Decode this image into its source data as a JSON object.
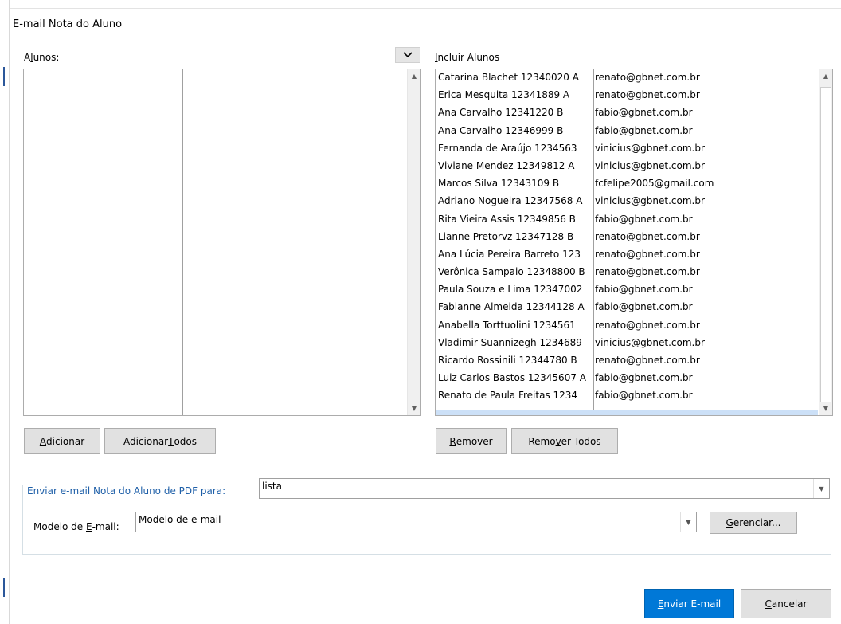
{
  "dialog": {
    "title": "E-mail Nota do Aluno"
  },
  "left": {
    "label_prefix": "A",
    "label_mnemonic": "l",
    "label_suffix": "unos:",
    "add_button": {
      "m": "A",
      "rest": "dicionar"
    },
    "add_all_button": {
      "pre": "Adicionar ",
      "m": "T",
      "rest": "odos"
    }
  },
  "right": {
    "label_mnemonic": "I",
    "label_rest": "ncluir Alunos",
    "rows": [
      {
        "name": "Catarina Blachet 12340020 A",
        "email": "renato@gbnet.com.br"
      },
      {
        "name": "Erica Mesquita 12341889 A",
        "email": "renato@gbnet.com.br"
      },
      {
        "name": "Ana Carvalho 12341220 B",
        "email": "fabio@gbnet.com.br"
      },
      {
        "name": "Ana Carvalho 12346999 B",
        "email": "fabio@gbnet.com.br"
      },
      {
        "name": "Fernanda de Araújo  1234563",
        "email": "vinicius@gbnet.com.br"
      },
      {
        "name": "Viviane Mendez 12349812 A",
        "email": "vinicius@gbnet.com.br"
      },
      {
        "name": "Marcos Silva 12343109 B",
        "email": "fcfelipe2005@gmail.com"
      },
      {
        "name": "Adriano Nogueira 12347568 A",
        "email": "vinicius@gbnet.com.br"
      },
      {
        "name": "Rita Vieira Assis 12349856 B",
        "email": "fabio@gbnet.com.br"
      },
      {
        "name": "Lianne Pretorvz 12347128 B",
        "email": "renato@gbnet.com.br"
      },
      {
        "name": "Ana Lúcia Pereira Barreto 123",
        "email": "renato@gbnet.com.br"
      },
      {
        "name": "Verônica Sampaio 12348800 B",
        "email": "renato@gbnet.com.br"
      },
      {
        "name": "Paula Souza e Lima 12347002",
        "email": "fabio@gbnet.com.br"
      },
      {
        "name": "Fabianne Almeida 12344128 A",
        "email": "fabio@gbnet.com.br"
      },
      {
        "name": "Anabella Torttuolini 1234561",
        "email": "renato@gbnet.com.br"
      },
      {
        "name": "Vladimir Suannizegh 1234689",
        "email": "vinicius@gbnet.com.br"
      },
      {
        "name": "Ricardo Rossinili 12344780 B",
        "email": "renato@gbnet.com.br"
      },
      {
        "name": "Luiz Carlos Bastos 12345607 A",
        "email": "fabio@gbnet.com.br"
      },
      {
        "name": "Renato de Paula Freitas 1234",
        "email": "fabio@gbnet.com.br"
      }
    ],
    "remove_button": {
      "m": "R",
      "rest": "emover"
    },
    "remove_all_button": {
      "pre": "Remo",
      "m": "v",
      "rest": "er Todos"
    }
  },
  "send_group": {
    "legend": "Enviar e-mail Nota do Aluno de PDF para:",
    "send_to_value": "lista",
    "template_label_pre": "Modelo de ",
    "template_label_m": "E",
    "template_label_rest": "-mail:",
    "template_value": "Modelo de e-mail",
    "manage_button": {
      "m": "G",
      "rest": "erenciar..."
    }
  },
  "footer": {
    "send_button": {
      "m": "E",
      "rest": "nviar E-mail"
    },
    "cancel_button": {
      "m": "C",
      "rest": "ancelar"
    }
  },
  "colors": {
    "accent": "#0078d7",
    "legend": "#1e5fa8",
    "selection": "#cce0f7"
  },
  "icons": {
    "dropdown": "chevron-down-icon",
    "scroll_up": "triangle-up-icon",
    "scroll_down": "triangle-down-icon"
  }
}
